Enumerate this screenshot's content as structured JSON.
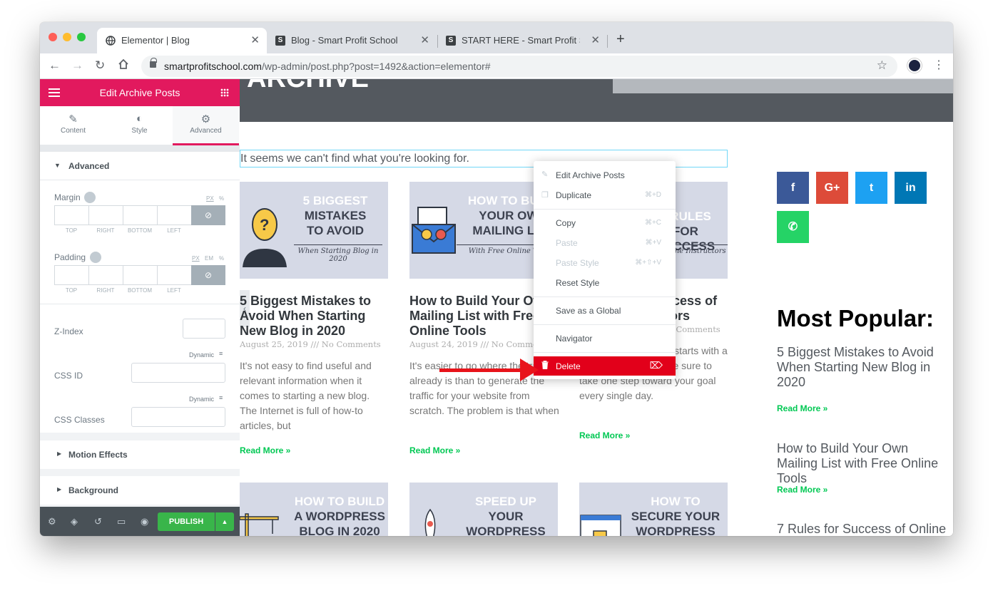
{
  "browser": {
    "tabs": [
      {
        "title": "Elementor | Blog"
      },
      {
        "title": "Blog - Smart Profit School"
      },
      {
        "title": "START HERE - Smart Profit Sc"
      }
    ],
    "new_tab_glyph": "+",
    "url_host": "smartprofitschool.com",
    "url_path": "/wp-admin/post.php?post=1492&action=elementor#"
  },
  "panel": {
    "title": "Edit Archive Posts",
    "tabs": [
      {
        "label": "Content",
        "icon": "pencil-icon"
      },
      {
        "label": "Style",
        "icon": "contrast-icon"
      },
      {
        "label": "Advanced",
        "icon": "gear-icon"
      }
    ],
    "active_tab": "Advanced",
    "section_title": "Advanced",
    "margin_label": "Margin",
    "padding_label": "Padding",
    "margin_units": [
      "PX",
      "%"
    ],
    "padding_units": [
      "PX",
      "EM",
      "%"
    ],
    "dim_labels": [
      "TOP",
      "RIGHT",
      "BOTTOM",
      "LEFT"
    ],
    "zindex_label": "Z-Index",
    "dynamic_label": "Dynamic",
    "cssid_label": "CSS ID",
    "cssclasses_label": "CSS Classes",
    "collapsed_sections": [
      "Motion Effects",
      "Background"
    ],
    "publish_label": "PUBLISH"
  },
  "page": {
    "hero_title": "ARCHIVE",
    "not_found": "It seems we can't find what you're looking for.",
    "posts": [
      {
        "thumb_lines": [
          "5 BIGGEST",
          "MISTAKES",
          "TO AVOID"
        ],
        "thumb_sub": "When Starting Blog in 2020",
        "title": "5 Biggest Mistakes to Avoid When Starting New Blog in 2020",
        "meta": "August 25, 2019 /// No Comments",
        "excerpt": "It's not easy to find useful and relevant information when it comes to starting a new blog. The Internet is full of how-to articles, but",
        "read_more": "Read More »"
      },
      {
        "thumb_lines": [
          "HOW TO BUILD",
          "YOUR OWN",
          "MAILING LIST"
        ],
        "thumb_sub": "With Free Online Tools",
        "title": "How to Build Your Own Mailing List with Free Online Tools",
        "meta": "August 24, 2019 /// No Comments",
        "excerpt": "It's easier to go where the traffic already is than to generate the traffic for your website from scratch. The problem is that when",
        "read_more": "Read More »"
      },
      {
        "thumb_lines": [
          "7 RULES",
          "FOR SUCCESS",
          ""
        ],
        "thumb_sub": "For Online Instructors",
        "title": "7 Rules for Success of Online Instructors",
        "meta": "August 23, 2019 /// No Comments",
        "excerpt": "Achieving your goals starts with a simple first step. Make sure to take one step toward your goal every single day.",
        "read_more": "Read More »"
      }
    ],
    "second_row": [
      {
        "lines": [
          "HOW TO BUILD",
          "A WORDPRESS",
          "BLOG IN 2020"
        ]
      },
      {
        "lines": [
          "SPEED UP",
          "YOUR",
          "WORDPRESS"
        ]
      },
      {
        "lines": [
          "HOW TO",
          "SECURE YOUR",
          "WORDPRESS"
        ]
      }
    ],
    "social": [
      {
        "name": "facebook",
        "glyph": "f",
        "color": "#3b5998"
      },
      {
        "name": "google-plus",
        "glyph": "G+",
        "color": "#dd4b39"
      },
      {
        "name": "twitter",
        "glyph": "t",
        "color": "#1da1f2"
      },
      {
        "name": "linkedin",
        "glyph": "in",
        "color": "#0077b5"
      },
      {
        "name": "whatsapp",
        "glyph": "✆",
        "color": "#25d366"
      }
    ],
    "most_popular_title": "Most Popular:",
    "most_popular": [
      {
        "title": "5 Biggest Mistakes to Avoid When Starting New Blog in 2020",
        "read_more": "Read More »"
      },
      {
        "title": "How to Build Your Own Mailing List with Free Online Tools",
        "read_more": "Read More »"
      },
      {
        "title": "7 Rules for Success of Online"
      }
    ]
  },
  "context_menu": {
    "edit": "Edit Archive Posts",
    "duplicate": "Duplicate",
    "duplicate_sc": "⌘+D",
    "copy": "Copy",
    "copy_sc": "⌘+C",
    "paste": "Paste",
    "paste_sc": "⌘+V",
    "paste_style": "Paste Style",
    "paste_style_sc": "⌘+⇧+V",
    "reset_style": "Reset Style",
    "save_global": "Save as a Global",
    "navigator": "Navigator",
    "delete": "Delete",
    "delete_sc": "⌦"
  },
  "colors": {
    "elementor_pink": "#e2195e",
    "publish_green": "#39b54a",
    "delete_red": "#e2001a",
    "read_more_green": "#00c853",
    "annotation_arrow": "#e8141b"
  }
}
